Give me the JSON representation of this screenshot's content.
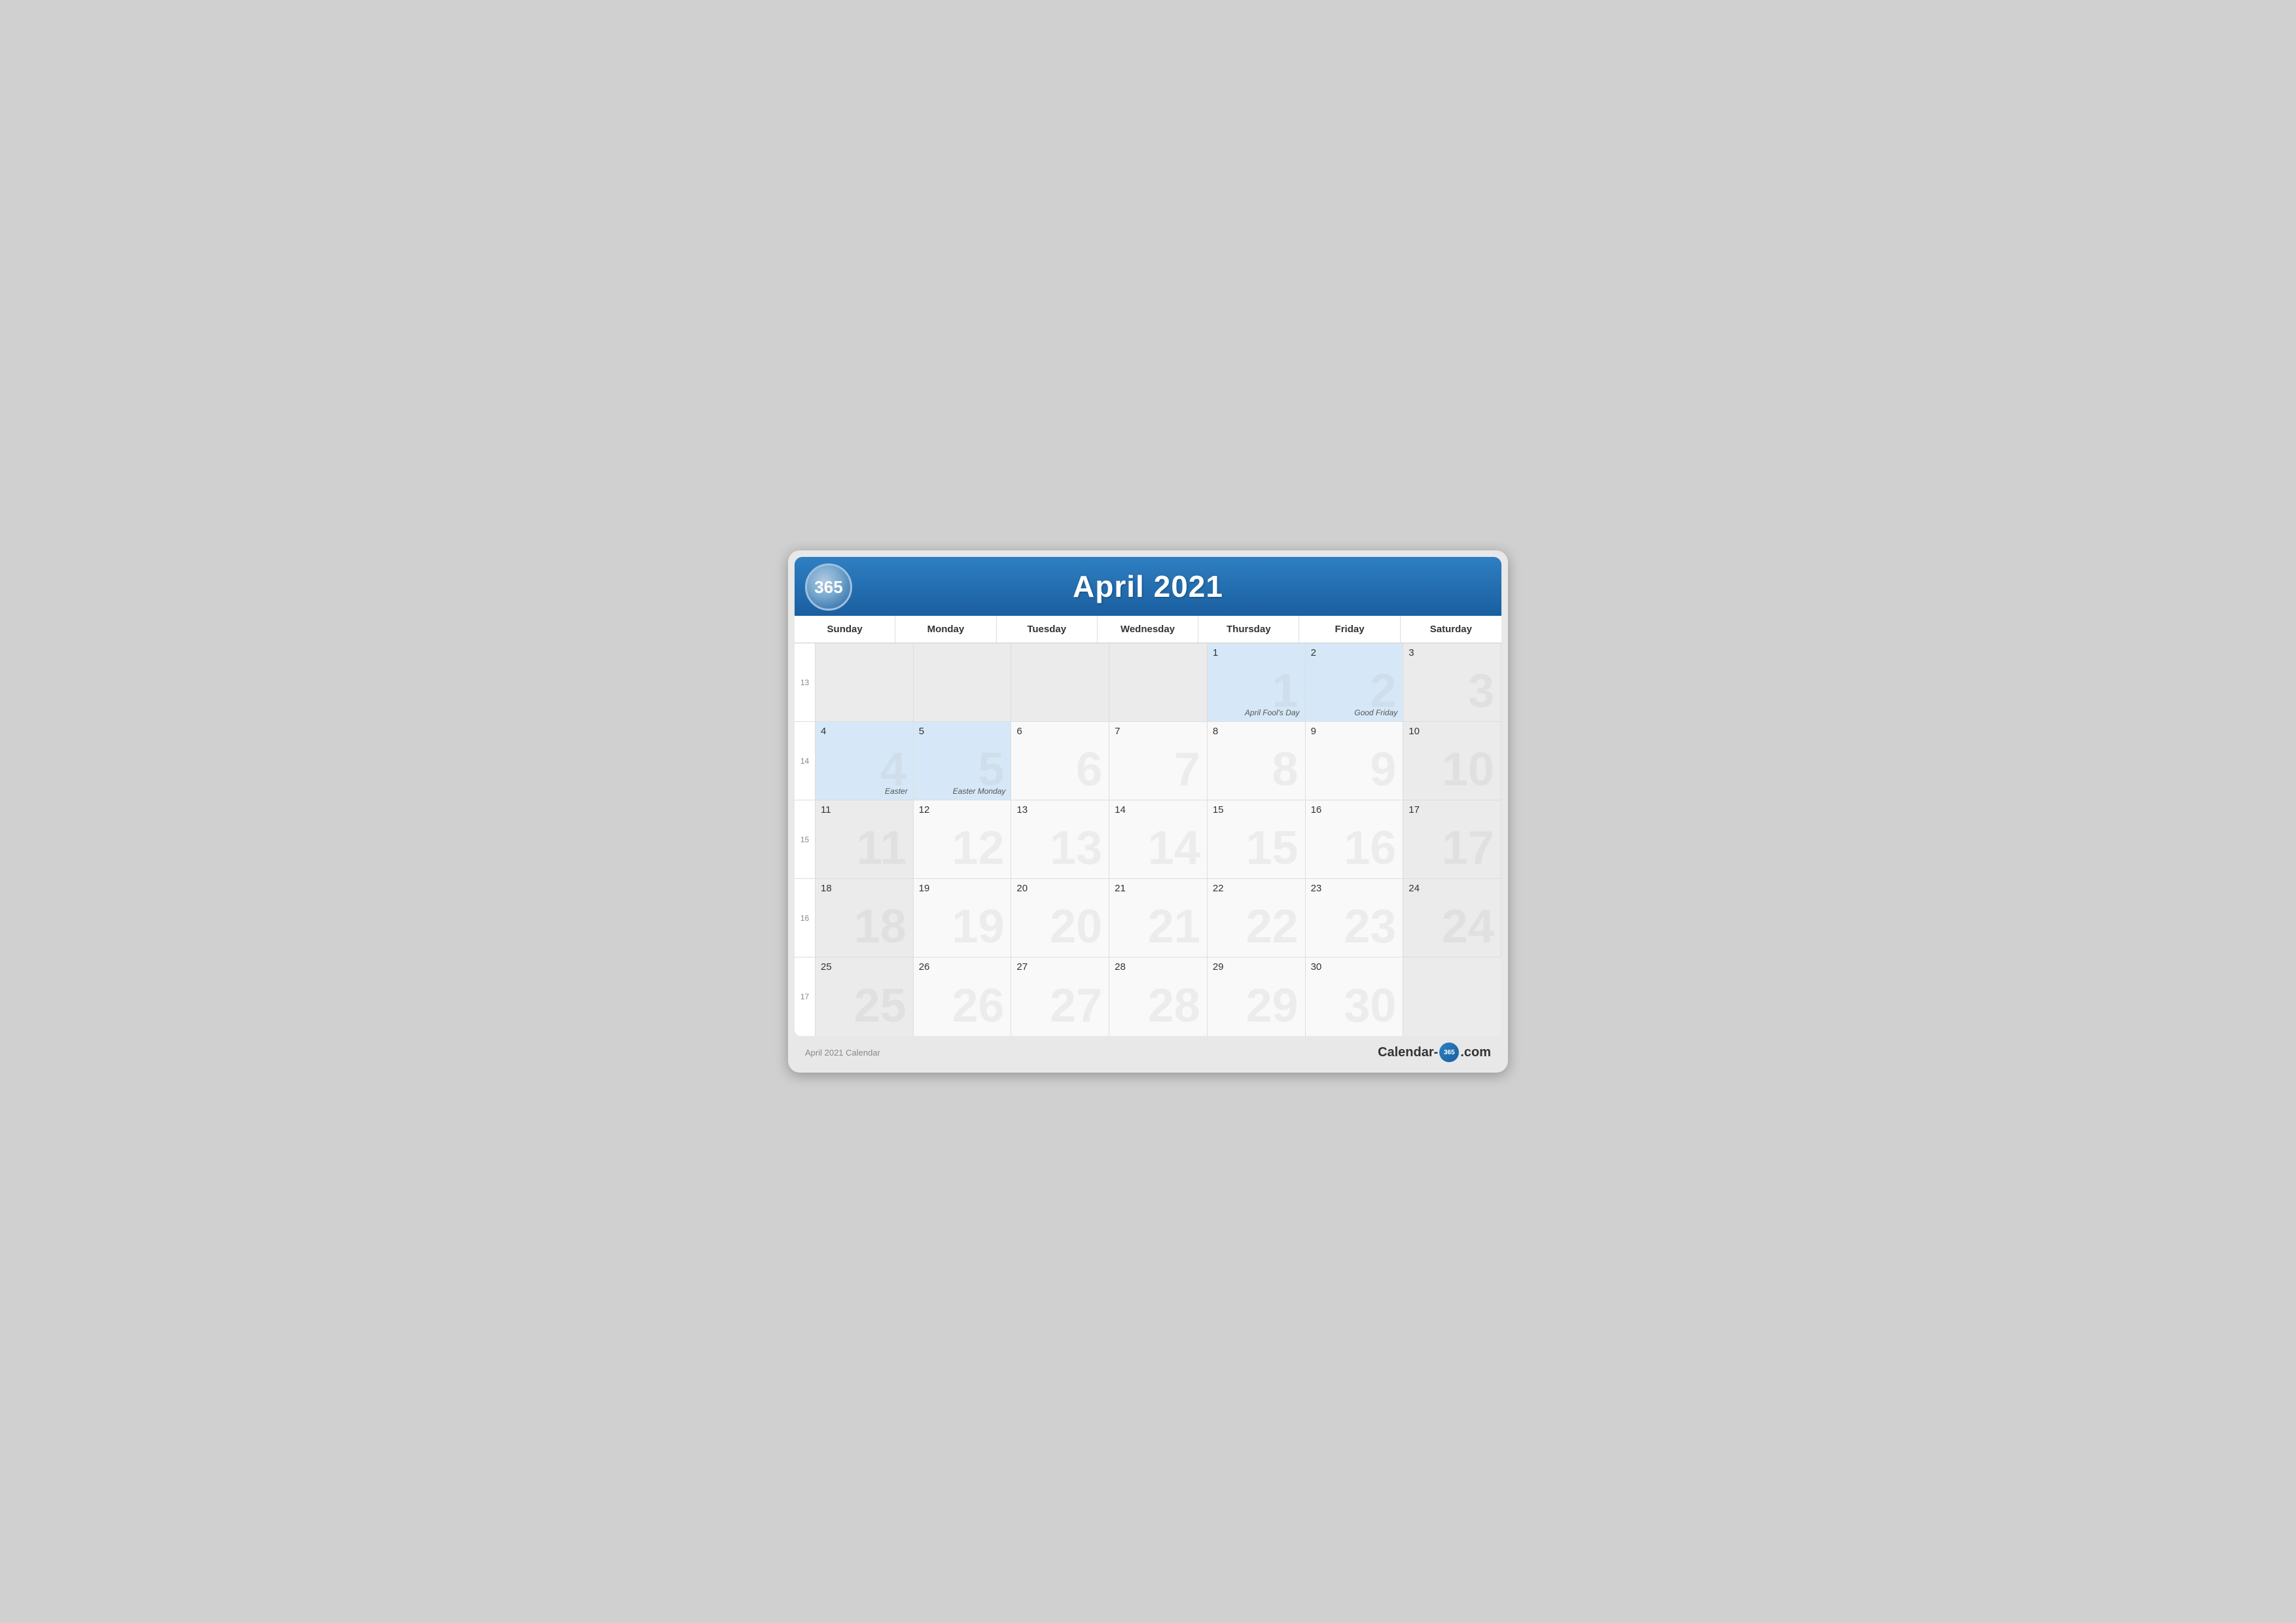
{
  "header": {
    "logo": "365",
    "title": "April 2021"
  },
  "days": {
    "headers": [
      "Sunday",
      "Monday",
      "Tuesday",
      "Wednesday",
      "Thursday",
      "Friday",
      "Saturday"
    ]
  },
  "weeks": [
    {
      "weekNum": "13",
      "days": [
        {
          "date": "",
          "month": "prev",
          "holiday": ""
        },
        {
          "date": "",
          "month": "prev",
          "holiday": ""
        },
        {
          "date": "",
          "month": "prev",
          "holiday": ""
        },
        {
          "date": "",
          "month": "prev",
          "holiday": ""
        },
        {
          "date": "1",
          "month": "current",
          "holiday": "April Fool's Day",
          "highlighted": true
        },
        {
          "date": "2",
          "month": "current",
          "holiday": "Good Friday",
          "highlighted": true
        },
        {
          "date": "3",
          "month": "current",
          "holiday": ""
        }
      ]
    },
    {
      "weekNum": "14",
      "days": [
        {
          "date": "4",
          "month": "current",
          "holiday": "Easter",
          "highlighted": true
        },
        {
          "date": "5",
          "month": "current",
          "holiday": "Easter Monday",
          "highlighted": true
        },
        {
          "date": "6",
          "month": "current",
          "holiday": ""
        },
        {
          "date": "7",
          "month": "current",
          "holiday": ""
        },
        {
          "date": "8",
          "month": "current",
          "holiday": ""
        },
        {
          "date": "9",
          "month": "current",
          "holiday": ""
        },
        {
          "date": "10",
          "month": "current",
          "holiday": ""
        }
      ]
    },
    {
      "weekNum": "15",
      "days": [
        {
          "date": "11",
          "month": "current",
          "holiday": ""
        },
        {
          "date": "12",
          "month": "current",
          "holiday": ""
        },
        {
          "date": "13",
          "month": "current",
          "holiday": ""
        },
        {
          "date": "14",
          "month": "current",
          "holiday": ""
        },
        {
          "date": "15",
          "month": "current",
          "holiday": ""
        },
        {
          "date": "16",
          "month": "current",
          "holiday": ""
        },
        {
          "date": "17",
          "month": "current",
          "holiday": ""
        }
      ]
    },
    {
      "weekNum": "16",
      "days": [
        {
          "date": "18",
          "month": "current",
          "holiday": ""
        },
        {
          "date": "19",
          "month": "current",
          "holiday": ""
        },
        {
          "date": "20",
          "month": "current",
          "holiday": ""
        },
        {
          "date": "21",
          "month": "current",
          "holiday": ""
        },
        {
          "date": "22",
          "month": "current",
          "holiday": ""
        },
        {
          "date": "23",
          "month": "current",
          "holiday": ""
        },
        {
          "date": "24",
          "month": "current",
          "holiday": ""
        }
      ]
    },
    {
      "weekNum": "17",
      "days": [
        {
          "date": "25",
          "month": "current",
          "holiday": ""
        },
        {
          "date": "26",
          "month": "current",
          "holiday": ""
        },
        {
          "date": "27",
          "month": "current",
          "holiday": ""
        },
        {
          "date": "28",
          "month": "current",
          "holiday": ""
        },
        {
          "date": "29",
          "month": "current",
          "holiday": ""
        },
        {
          "date": "30",
          "month": "current",
          "holiday": ""
        },
        {
          "date": "",
          "month": "next",
          "holiday": ""
        }
      ]
    }
  ],
  "footer": {
    "left": "April 2021 Calendar",
    "right_prefix": "Calendar-",
    "right_logo": "365",
    "right_suffix": ".com"
  }
}
